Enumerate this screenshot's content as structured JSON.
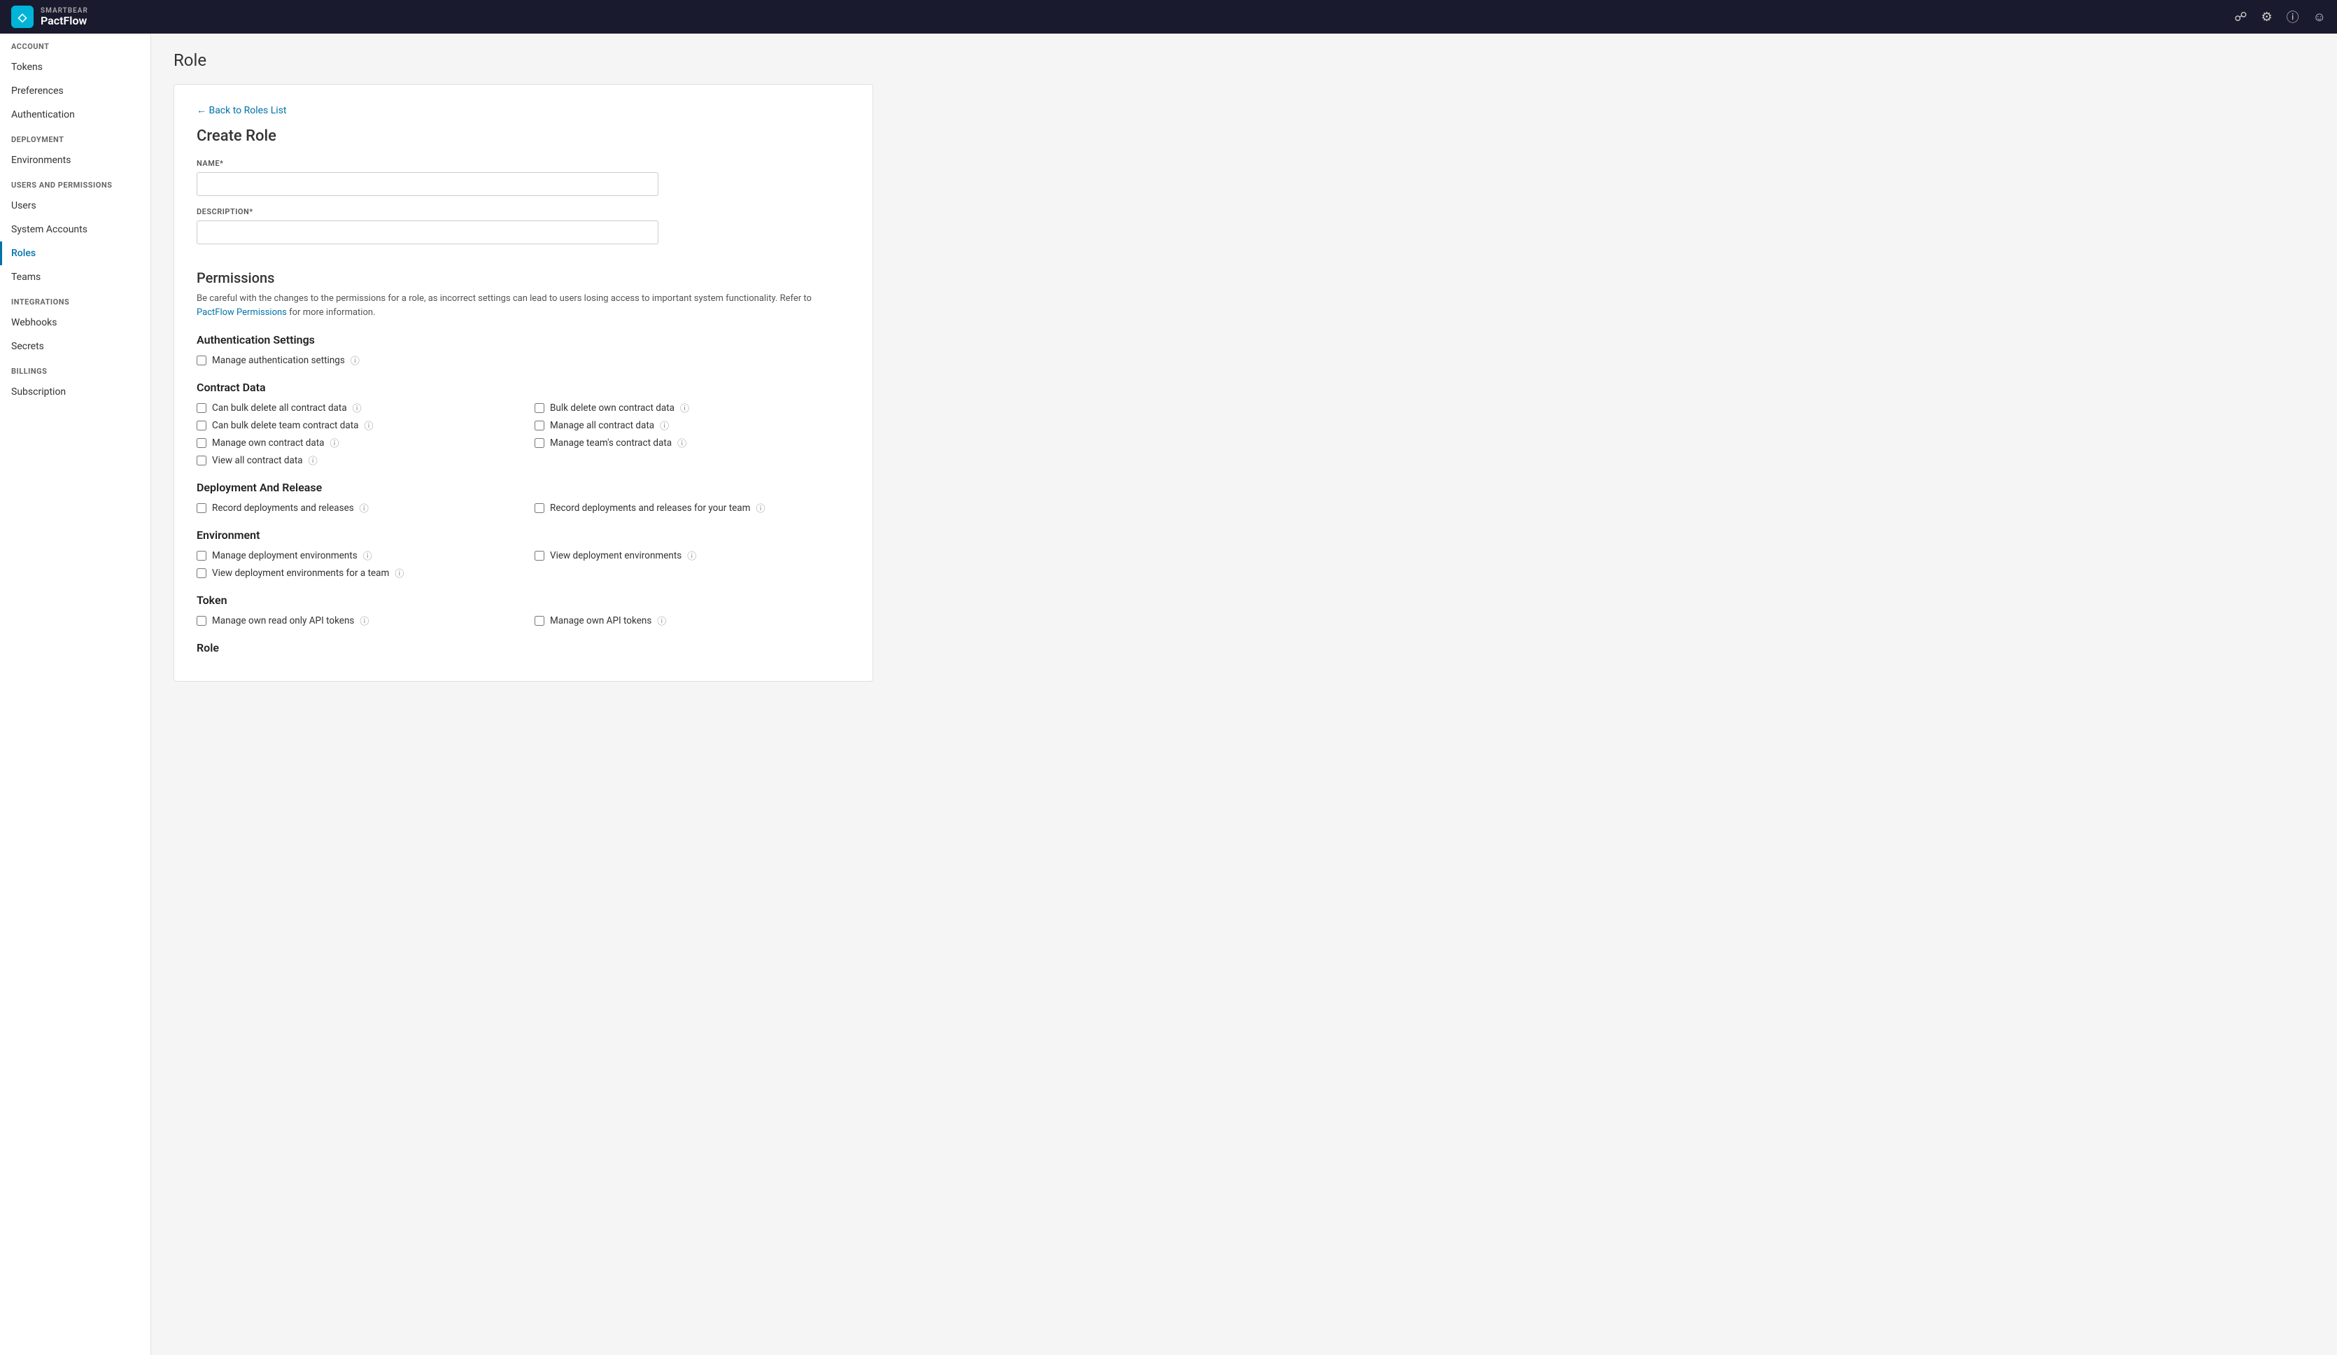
{
  "app": {
    "brand": "SMARTBEAR",
    "product": "PactFlow"
  },
  "topnav": {
    "icons": [
      "chat-icon",
      "settings-icon",
      "help-icon",
      "user-icon"
    ]
  },
  "sidebar": {
    "account_section": "ACCOUNT",
    "deployment_section": "DEPLOYMENT",
    "users_permissions_section": "USERS AND PERMISSIONS",
    "integrations_section": "INTEGRATIONS",
    "billings_section": "BILLINGS",
    "items": [
      {
        "id": "tokens",
        "label": "Tokens",
        "active": false
      },
      {
        "id": "preferences",
        "label": "Preferences",
        "active": false
      },
      {
        "id": "authentication",
        "label": "Authentication",
        "active": false
      },
      {
        "id": "environments",
        "label": "Environments",
        "active": false
      },
      {
        "id": "users",
        "label": "Users",
        "active": false
      },
      {
        "id": "system-accounts",
        "label": "System Accounts",
        "active": false
      },
      {
        "id": "roles",
        "label": "Roles",
        "active": true
      },
      {
        "id": "teams",
        "label": "Teams",
        "active": false
      },
      {
        "id": "webhooks",
        "label": "Webhooks",
        "active": false
      },
      {
        "id": "secrets",
        "label": "Secrets",
        "active": false
      },
      {
        "id": "subscription",
        "label": "Subscription",
        "active": false
      }
    ]
  },
  "page": {
    "title": "Role",
    "back_link": "← Back to Roles List",
    "create_title": "Create Role",
    "name_label": "NAME*",
    "description_label": "DESCRIPTION*",
    "permissions_title": "Permissions",
    "permissions_warning": "Be careful with the changes to the permissions for a role, as incorrect settings can lead to users losing access to important system functionality. Refer to ",
    "permissions_link_text": "PactFlow Permissions",
    "permissions_warning_end": " for more information.",
    "sections": [
      {
        "id": "authentication-settings",
        "title": "Authentication Settings",
        "layout": "single",
        "items": [
          {
            "id": "manage-auth-settings",
            "label": "Manage authentication settings",
            "has_help": true
          }
        ]
      },
      {
        "id": "contract-data",
        "title": "Contract Data",
        "layout": "grid",
        "items": [
          {
            "id": "bulk-delete-all",
            "label": "Can bulk delete all contract data",
            "has_help": true,
            "col": 1
          },
          {
            "id": "bulk-delete-own",
            "label": "Bulk delete own contract data",
            "has_help": true,
            "col": 2
          },
          {
            "id": "bulk-delete-team",
            "label": "Can bulk delete team contract data",
            "has_help": true,
            "col": 1
          },
          {
            "id": "manage-all-contract",
            "label": "Manage all contract data",
            "has_help": true,
            "col": 2
          },
          {
            "id": "manage-own-contract",
            "label": "Manage own contract data",
            "has_help": true,
            "col": 1
          },
          {
            "id": "manage-team-contract",
            "label": "Manage team's contract data",
            "has_help": true,
            "col": 2
          },
          {
            "id": "view-all-contract",
            "label": "View all contract data",
            "has_help": true,
            "col": 1
          }
        ]
      },
      {
        "id": "deployment-release",
        "title": "Deployment And Release",
        "layout": "grid",
        "items": [
          {
            "id": "record-deployments",
            "label": "Record deployments and releases",
            "has_help": true,
            "col": 1
          },
          {
            "id": "record-deployments-team",
            "label": "Record deployments and releases for your team",
            "has_help": true,
            "col": 2
          }
        ]
      },
      {
        "id": "environment",
        "title": "Environment",
        "layout": "grid",
        "items": [
          {
            "id": "manage-deployment-envs",
            "label": "Manage deployment environments",
            "has_help": true,
            "col": 1
          },
          {
            "id": "view-deployment-envs",
            "label": "View deployment environments",
            "has_help": true,
            "col": 2
          },
          {
            "id": "view-deployment-envs-team",
            "label": "View deployment environments for a team",
            "has_help": true,
            "col": 1
          }
        ]
      },
      {
        "id": "token",
        "title": "Token",
        "layout": "grid",
        "items": [
          {
            "id": "manage-own-read-tokens",
            "label": "Manage own read only API tokens",
            "has_help": true,
            "col": 1
          },
          {
            "id": "manage-own-api-tokens",
            "label": "Manage own API tokens",
            "has_help": true,
            "col": 2
          }
        ]
      },
      {
        "id": "role",
        "title": "Role",
        "layout": "grid",
        "items": []
      }
    ]
  }
}
